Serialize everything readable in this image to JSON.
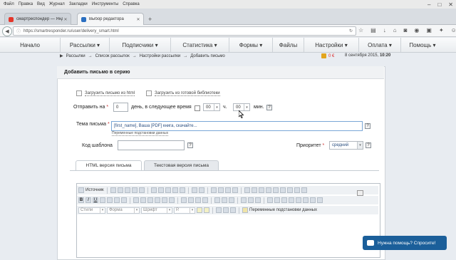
{
  "browser": {
    "menu": [
      "Файл",
      "Правка",
      "Вид",
      "Журнал",
      "Закладки",
      "Инструменты",
      "Справка"
    ],
    "tabs": [
      {
        "label": "смартреспондер — Яндекс...",
        "active": false,
        "favicon_color": "#e5362a"
      },
      {
        "label": "Выбор редактора",
        "active": true,
        "favicon_color": "#2a6fc1"
      }
    ],
    "new_tab": "+",
    "window_buttons": [
      "–",
      "□",
      "✕"
    ],
    "url": "https://smartresponder.ru/user/delivery_smart.html"
  },
  "site_nav": {
    "items": [
      "Начало",
      "Рассылки ▾",
      "Подписчики ▾",
      "Статистика ▾",
      "Формы ▾",
      "Файлы",
      "Настройки ▾",
      "Оплата ▾",
      "Помощь ▾"
    ]
  },
  "breadcrumbs": [
    "Рассылки",
    "Список рассылок",
    "Настройки рассылки",
    "Добавить письмо"
  ],
  "breadcrumb_sep": "→",
  "balance": "0 €",
  "date": {
    "day": "8 сентября 2015,",
    "time": "10:20"
  },
  "form": {
    "title": "Добавить письмо в серию",
    "upload_html": "Загрузить письмо из html",
    "upload_library": "Загрузить из готовой библиотеки",
    "send_label": "Отправить на",
    "days_value": "0",
    "days_text": "день, в следующее время",
    "hours_value": "00",
    "hours_unit": "ч.",
    "minutes_value": "00",
    "minutes_unit": "мин.",
    "subject_label": "Тема письма",
    "subject_value": "[first_name], Ваша [PDF] книга, скачайте...",
    "subject_hint": "Переменные подстановки данных",
    "template_label": "Код шаблона",
    "priority_label": "Приоритет",
    "priority_value": "средний",
    "required_mark": "*",
    "help": "?"
  },
  "editor": {
    "tabs": [
      "HTML версия письма",
      "Текстовая версия письма"
    ],
    "source_button": "Источник",
    "styles": "Стили",
    "format": "Форма",
    "font": "Шрифт",
    "size": "Р.",
    "vars_button": "Переменные подстановки данных"
  },
  "chat": {
    "label": "Нужна помощь? Спросите!"
  }
}
